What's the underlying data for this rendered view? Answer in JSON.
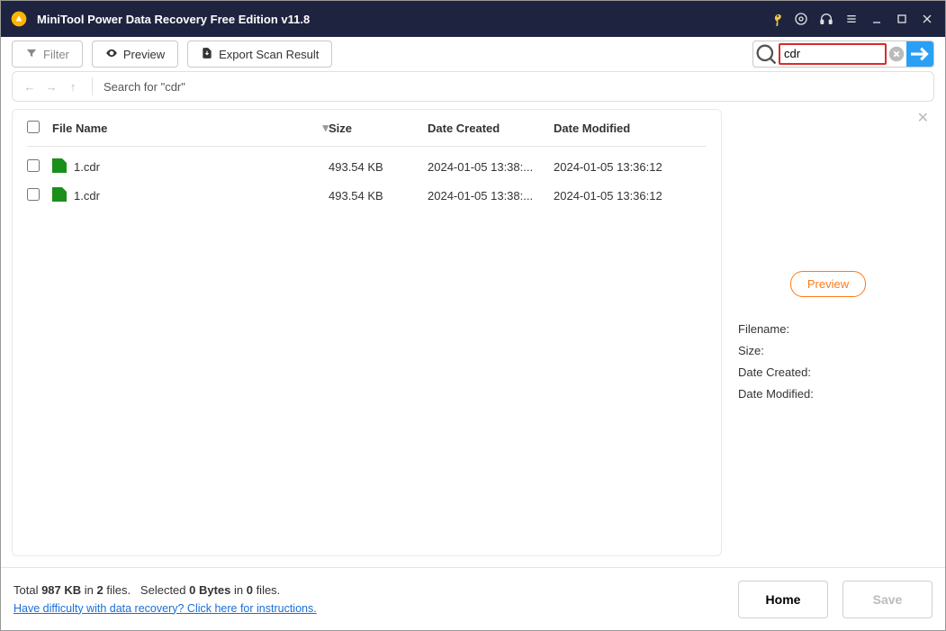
{
  "title": "MiniTool Power Data Recovery Free Edition v11.8",
  "toolbar": {
    "filter_label": "Filter",
    "preview_label": "Preview",
    "export_label": "Export Scan Result"
  },
  "search": {
    "value": "cdr"
  },
  "breadcrumb": {
    "text": "Search for  \"cdr\""
  },
  "columns": {
    "name": "File Name",
    "size": "Size",
    "created": "Date Created",
    "modified": "Date Modified"
  },
  "files": [
    {
      "name": "1.cdr",
      "size": "493.54 KB",
      "created": "2024-01-05 13:38:...",
      "modified": "2024-01-05 13:36:12"
    },
    {
      "name": "1.cdr",
      "size": "493.54 KB",
      "created": "2024-01-05 13:38:...",
      "modified": "2024-01-05 13:36:12"
    }
  ],
  "preview": {
    "button": "Preview",
    "meta": {
      "filename_label": "Filename:",
      "size_label": "Size:",
      "created_label": "Date Created:",
      "modified_label": "Date Modified:"
    }
  },
  "footer": {
    "total_prefix": "Total ",
    "total_size": "987 KB",
    "total_mid": " in ",
    "total_files": "2",
    "total_suffix": " files.",
    "selected_prefix": "Selected ",
    "selected_size": "0 Bytes",
    "selected_mid": " in ",
    "selected_files": "0",
    "selected_suffix": " files.",
    "help_link": "Have difficulty with data recovery? Click here for instructions.",
    "home_label": "Home",
    "save_label": "Save"
  }
}
